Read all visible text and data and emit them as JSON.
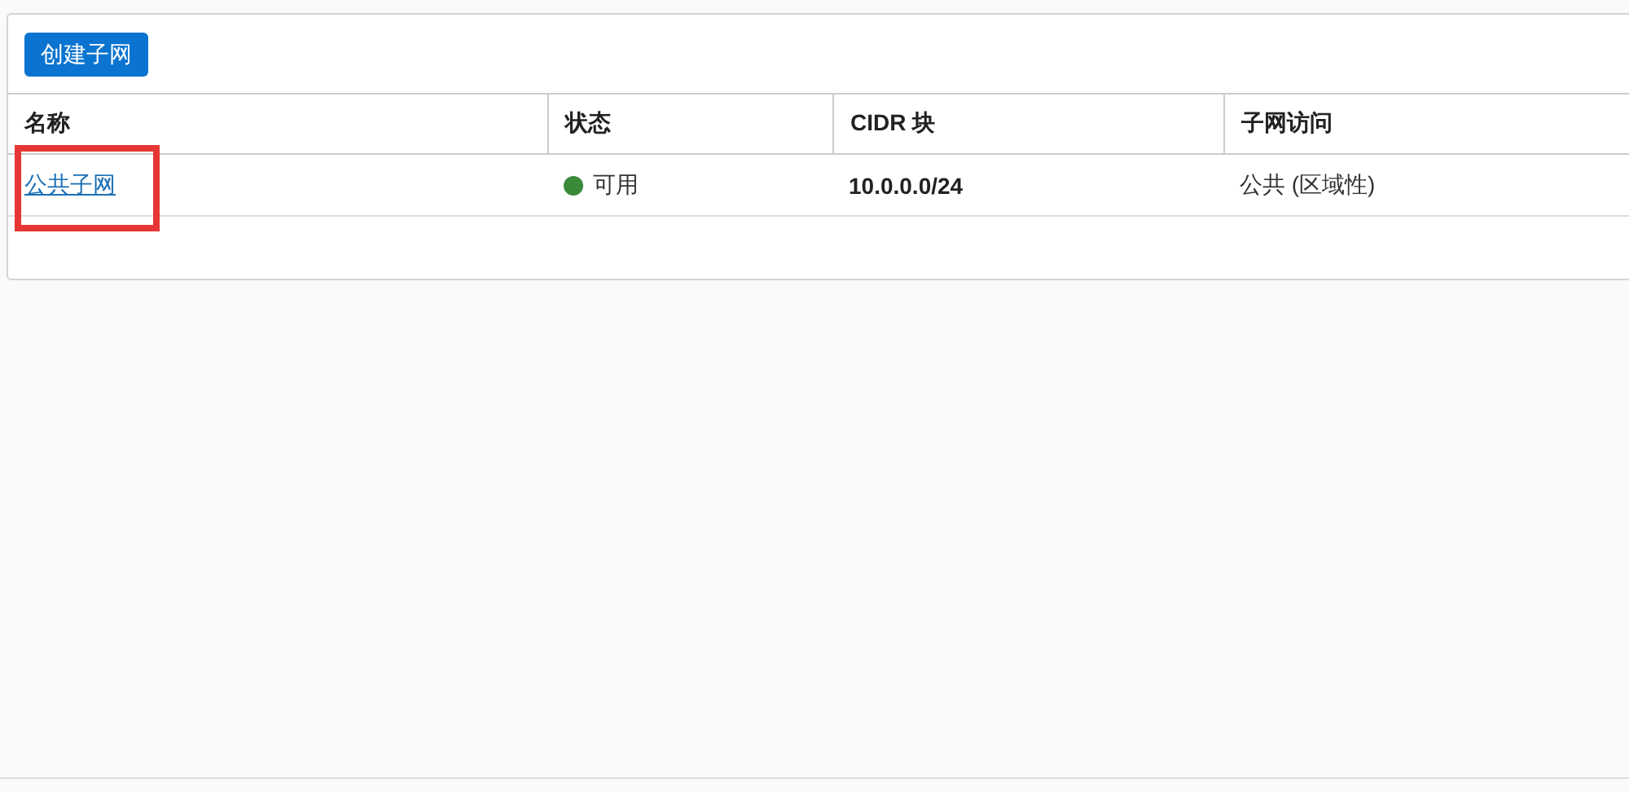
{
  "toolbar": {
    "create_button": "创建子网"
  },
  "table": {
    "columns": [
      "名称",
      "状态",
      "CIDR 块",
      "子网访问"
    ],
    "rows": [
      {
        "name": "公共子网",
        "name_highlighted": true,
        "status": "可用",
        "color": "#3a8a3a",
        "cidr": "10.0.0.0/24",
        "access": "公共 (区域性)"
      }
    ]
  }
}
